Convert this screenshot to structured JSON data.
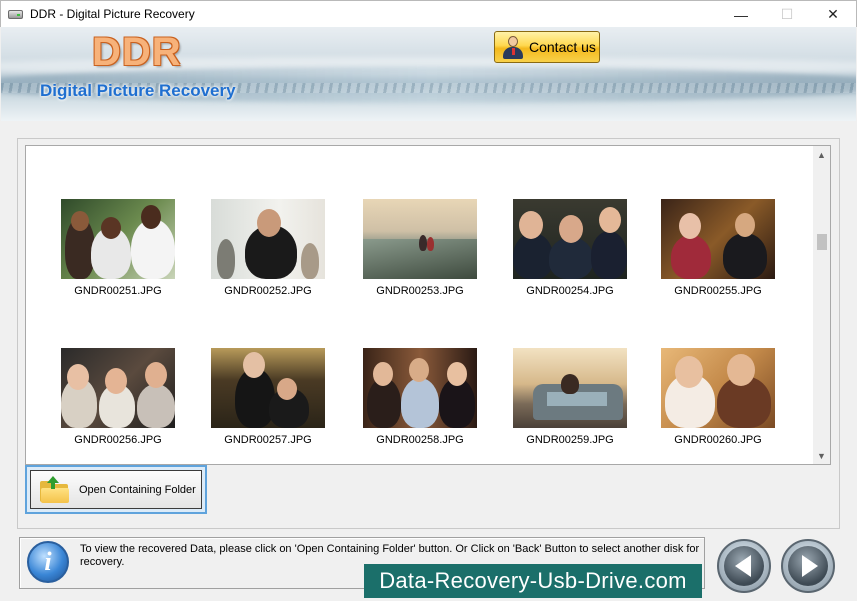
{
  "window": {
    "title": "DDR - Digital Picture Recovery",
    "minimize": "—",
    "maximize": "☐",
    "close": "✕"
  },
  "header": {
    "logo": "DDR",
    "subtitle": "Digital Picture Recovery",
    "contact_label": "Contact us"
  },
  "thumbnails": [
    {
      "file": "GNDR00251.JPG"
    },
    {
      "file": "GNDR00252.JPG"
    },
    {
      "file": "GNDR00253.JPG"
    },
    {
      "file": "GNDR00254.JPG"
    },
    {
      "file": "GNDR00255.JPG"
    },
    {
      "file": "GNDR00256.JPG"
    },
    {
      "file": "GNDR00257.JPG"
    },
    {
      "file": "GNDR00258.JPG"
    },
    {
      "file": "GNDR00259.JPG"
    },
    {
      "file": "GNDR00260.JPG"
    }
  ],
  "actions": {
    "open_folder_label": "Open Containing Folder"
  },
  "footer": {
    "info_glyph": "i",
    "info_text": "To view the recovered Data, please click on 'Open Containing Folder' button. Or Click on 'Back' Button to select another disk for recovery.",
    "watermark": "Data-Recovery-Usb-Drive.com"
  },
  "colors": {
    "accent_blue": "#1f6fd0",
    "logo_orange": "#f7b27a",
    "contact_gold": "#ffd84f",
    "watermark_teal": "#1b6f6a"
  }
}
